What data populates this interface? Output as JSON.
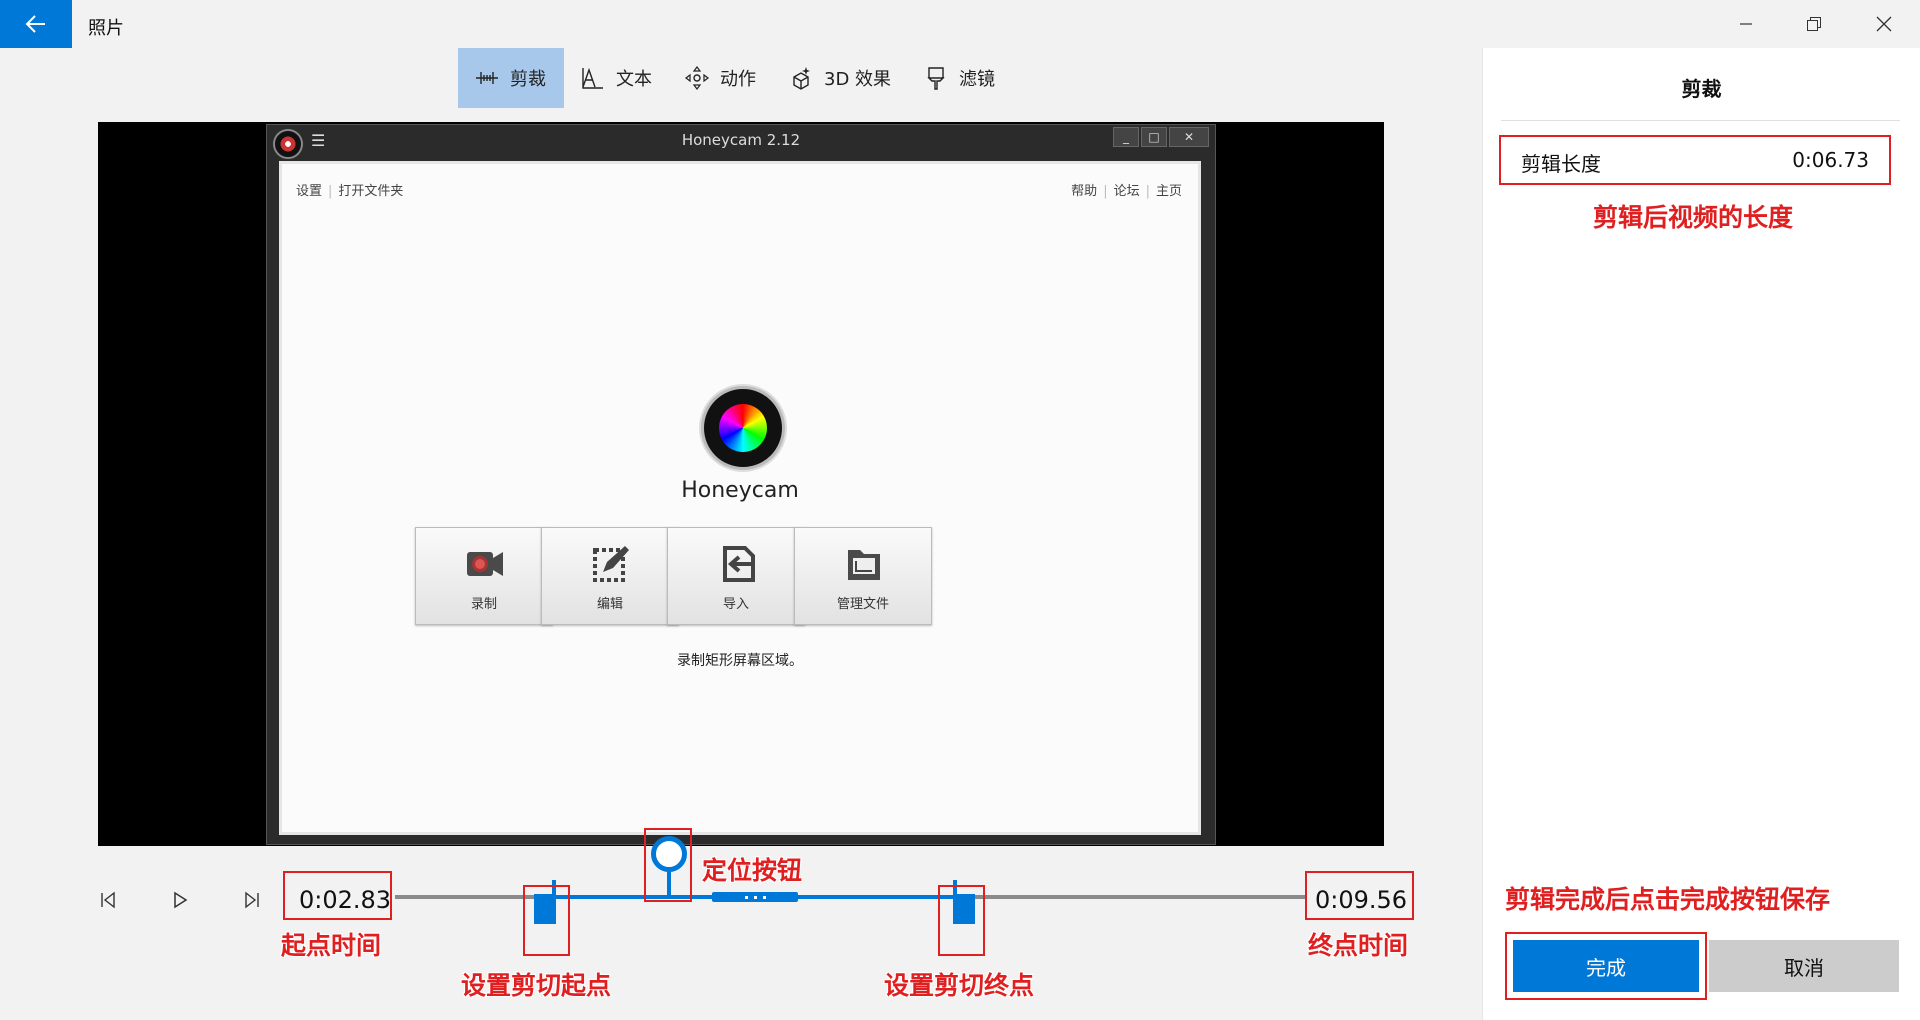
{
  "app": {
    "title": "照片"
  },
  "toolbar": {
    "items": [
      {
        "label": "剪裁",
        "icon": "trim-icon",
        "active": true
      },
      {
        "label": "文本",
        "icon": "text-icon",
        "active": false
      },
      {
        "label": "动作",
        "icon": "motion-icon",
        "active": false
      },
      {
        "label": "3D 效果",
        "icon": "3d-effects-icon",
        "active": false
      },
      {
        "label": "滤镜",
        "icon": "filter-icon",
        "active": false
      }
    ]
  },
  "video": {
    "honeycam": {
      "window_title": "Honeycam 2.12",
      "links_left": [
        "设置",
        "打开文件夹"
      ],
      "links_right": [
        "帮助",
        "论坛",
        "主页"
      ],
      "app_name": "Honeycam",
      "buttons": [
        "录制",
        "编辑",
        "导入",
        "管理文件"
      ],
      "description": "录制矩形屏幕区域。"
    }
  },
  "timeline": {
    "start_time": "0:02.83",
    "end_time": "0:09.56"
  },
  "panel": {
    "title": "剪裁",
    "length_label": "剪辑长度",
    "length_value": "0:06.73",
    "done_label": "完成",
    "cancel_label": "取消"
  },
  "annotations": {
    "length_note": "剪辑后视频的长度",
    "save_note": "剪辑完成后点击完成按钮保存",
    "seek_note": "定位按钮",
    "start_note": "起点时间",
    "end_note": "终点时间",
    "trim_start_note": "设置剪切起点",
    "trim_end_note": "设置剪切终点"
  },
  "colors": {
    "accent": "#0078d7",
    "annotation": "#e02020",
    "active_tool_bg": "#a7c8ea"
  }
}
